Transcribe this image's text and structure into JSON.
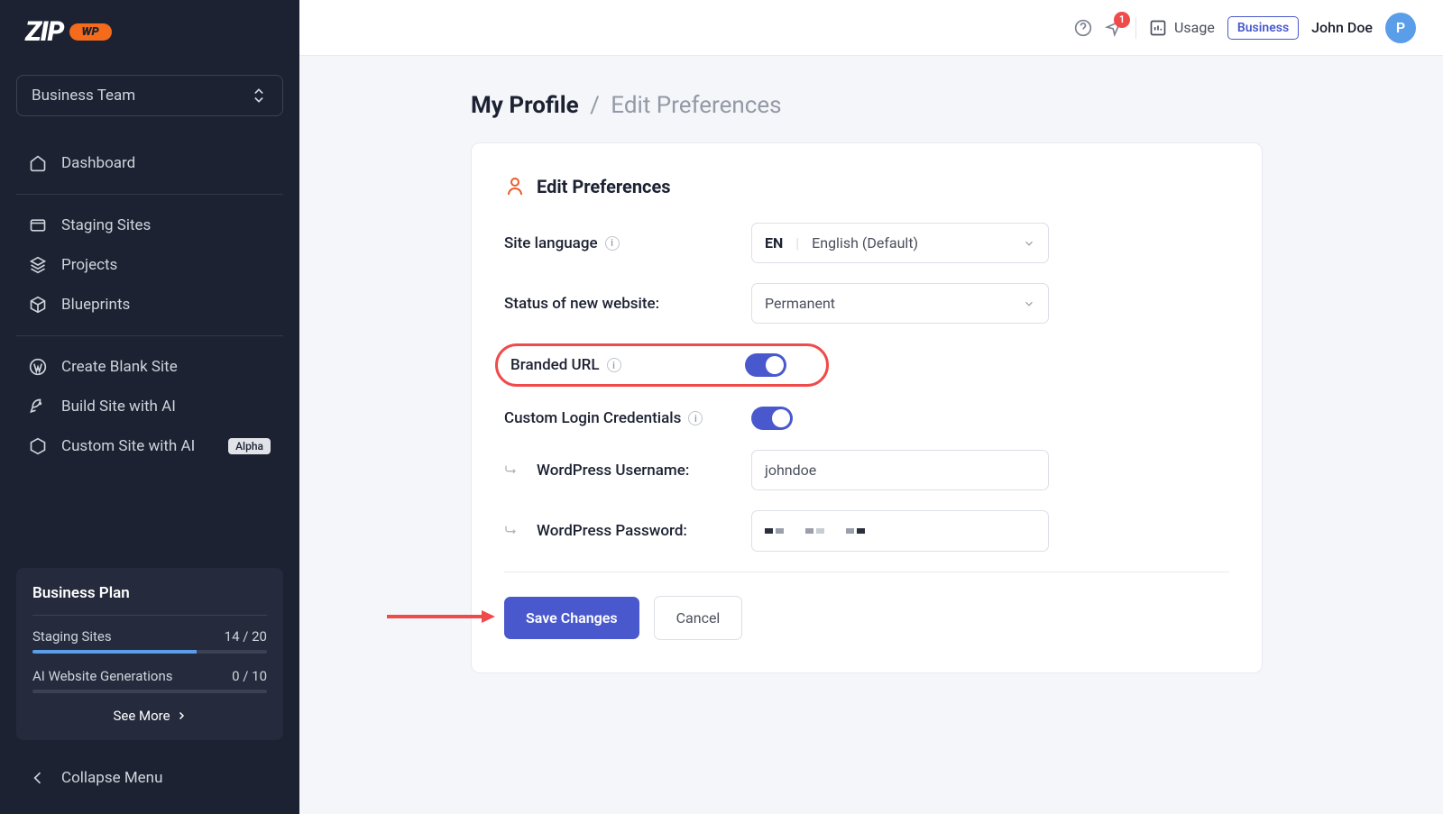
{
  "logo": {
    "text": "ZIP",
    "badge": "WP"
  },
  "team_selector": "Business Team",
  "nav": {
    "dashboard": "Dashboard",
    "staging": "Staging Sites",
    "projects": "Projects",
    "blueprints": "Blueprints",
    "create_blank": "Create Blank Site",
    "build_ai": "Build Site with AI",
    "custom_ai": "Custom Site with AI",
    "custom_ai_badge": "Alpha",
    "collapse": "Collapse Menu"
  },
  "plan": {
    "title": "Business Plan",
    "staging_label": "Staging Sites",
    "staging_value": "14 / 20",
    "staging_pct": 70,
    "ai_label": "AI Website Generations",
    "ai_value": "0 / 10",
    "ai_pct": 0,
    "see_more": "See More"
  },
  "header": {
    "notif_count": "1",
    "usage": "Usage",
    "business": "Business",
    "user_name": "John Doe",
    "avatar_initial": "P"
  },
  "breadcrumb": {
    "main": "My Profile",
    "sub": "Edit Preferences"
  },
  "card": {
    "title": "Edit Preferences",
    "site_language_label": "Site language",
    "lang_code": "EN",
    "lang_value": "English (Default)",
    "status_label": "Status of new website:",
    "status_value": "Permanent",
    "branded_label": "Branded URL",
    "custom_login_label": "Custom Login Credentials",
    "wp_user_label": "WordPress Username:",
    "wp_user_value": "johndoe",
    "wp_pass_label": "WordPress Password:",
    "save": "Save Changes",
    "cancel": "Cancel"
  }
}
